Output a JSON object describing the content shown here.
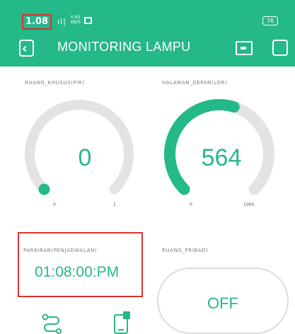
{
  "status": {
    "time": "1.08",
    "signal": "ıl|",
    "net_top": "0.43",
    "net_bottom": "KB/S",
    "battery": "76"
  },
  "toolbar": {
    "title": "MONITORING LAMPU"
  },
  "gauges": [
    {
      "label": "RUANG_KHUSUS(PIR)",
      "value": "0",
      "min": "0",
      "max": "1",
      "fraction": 0.0
    },
    {
      "label": "HALAMAN_DEPAN(LDR)",
      "value": "564",
      "min": "0",
      "max": "1000",
      "fraction": 0.564
    }
  ],
  "schedule": {
    "label": "PARKIRAN(PENJADWALAN)",
    "time": "01:08:00:PM"
  },
  "switch": {
    "label": "RUANG_PRIBADI",
    "state": "OFF"
  },
  "colors": {
    "accent": "#25b889",
    "track": "#e3e3e3",
    "highlight": "#d63232"
  },
  "icons": [
    "back-icon",
    "device-icon",
    "square-icon",
    "route-icon",
    "phone-icon"
  ]
}
